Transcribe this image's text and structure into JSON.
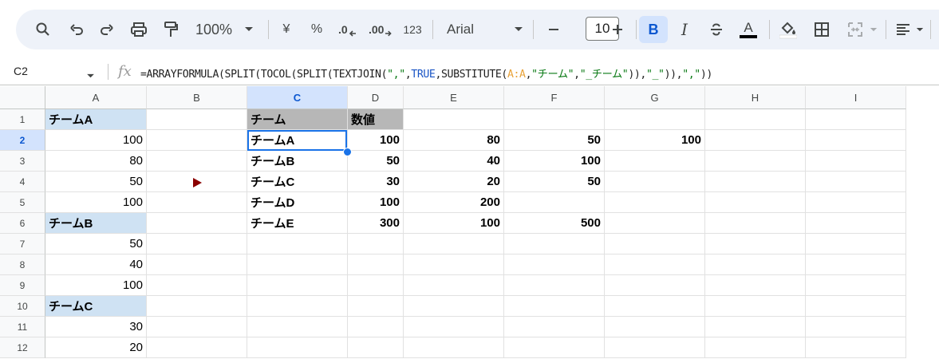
{
  "toolbar": {
    "zoom": "100%",
    "currency": "¥",
    "percent": "%",
    "dec_decrease": ".0",
    "dec_increase": ".00",
    "number_format": "123",
    "font_name": "Arial",
    "font_size": "10",
    "bold": "B",
    "italic": "I",
    "text_color_letter": "A"
  },
  "formula_bar": {
    "cell_ref": "C2",
    "fx": "fx",
    "formula_parts": [
      "=ARRAYFORMULA(SPLIT(TOCOL(SPLIT(TEXTJOIN(",
      "\",\"",
      ",",
      "TRUE",
      ",SUBSTITUTE(",
      "A:A",
      ",",
      "\"チーム\"",
      ",",
      "\"_チーム\"",
      ")),",
      "\"_\"",
      ")),",
      "\",\"",
      "))"
    ]
  },
  "columns": [
    "A",
    "B",
    "C",
    "D",
    "E",
    "F",
    "G",
    "H",
    "I"
  ],
  "rows": [
    "1",
    "2",
    "3",
    "4",
    "5",
    "6",
    "7",
    "8",
    "9",
    "10",
    "11",
    "12"
  ],
  "cells": {
    "A1": "チームA",
    "A2": "100",
    "A3": "80",
    "A4": "50",
    "A5": "100",
    "A6": "チームB",
    "A7": "50",
    "A8": "40",
    "A9": "100",
    "A10": "チームC",
    "A11": "30",
    "A12": "20",
    "C1": "チーム",
    "D1": "数値",
    "C2": "チームA",
    "D2": "100",
    "E2": "80",
    "F2": "50",
    "G2": "100",
    "C3": "チームB",
    "D3": "50",
    "E3": "40",
    "F3": "100",
    "C4": "チームC",
    "D4": "30",
    "E4": "20",
    "F4": "50",
    "C5": "チームD",
    "D5": "100",
    "E5": "200",
    "C6": "チームE",
    "D6": "300",
    "E6": "100",
    "F6": "500"
  },
  "colors": {
    "team_header_bg": "#cfe2f3",
    "output_header_bg": "#b7b7b7",
    "selection": "#1a73e8",
    "arrow": "#8b0000"
  }
}
